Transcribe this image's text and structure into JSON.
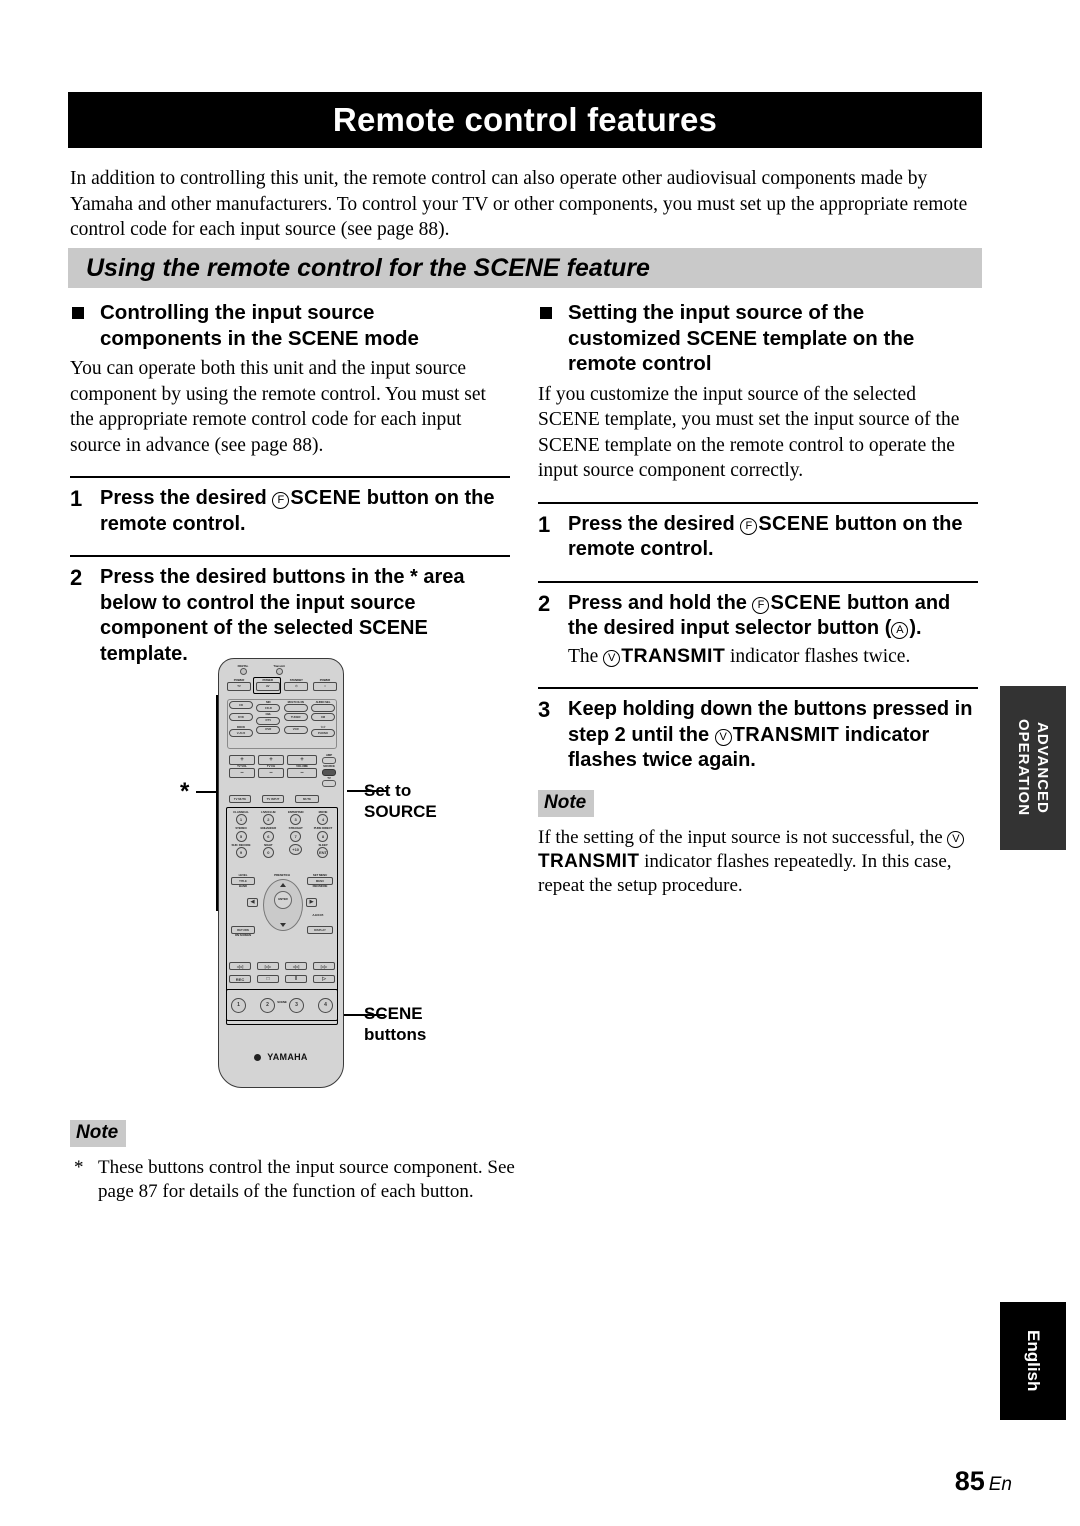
{
  "header": {
    "title": "Remote control features"
  },
  "intro": "In addition to controlling this unit, the remote control can also operate other audiovisual components made by Yamaha and other manufacturers. To control your TV or other components, you must set up the appropriate remote control code for each input source (see page 88).",
  "section": {
    "title": "Using the remote control for the SCENE feature"
  },
  "left_column": {
    "heading": "Controlling the input source components in the SCENE mode",
    "heading_line1": "Controlling the input source",
    "heading_line2": "components in the SCENE mode",
    "body": "You can operate both this unit and the input source component by using the remote control. You must set the appropriate remote control code for each input source in advance (see page 88).",
    "steps": [
      {
        "number": "1",
        "text_before": "Press the desired ",
        "circled": "F",
        "bold_token": "SCENE",
        "text_after": " button on the remote control."
      },
      {
        "number": "2",
        "text_before": "Press the desired buttons in the * area below to control the input source component of the selected SCENE template.",
        "circled": "",
        "bold_token": "",
        "text_after": ""
      }
    ],
    "note": {
      "badge": "Note",
      "star": "*",
      "text": "These buttons control the input source component. See page 87 for details of the function of each button."
    }
  },
  "right_column": {
    "heading_line1": "Setting the input source of the",
    "heading_line2": "customized SCENE template on the",
    "heading_line3": "remote control",
    "body": "If you customize the input source of the selected SCENE template, you must set the input source of the SCENE template on the remote control to operate the input source component correctly.",
    "steps": [
      {
        "number": "1",
        "text_before": "Press the desired ",
        "circled": "F",
        "bold_token": "SCENE",
        "text_after": " button on the remote control.",
        "sub": ""
      },
      {
        "number": "2",
        "text_before": "Press and hold the ",
        "circled": "F",
        "bold_token": "SCENE",
        "text_after": " button and the desired input selector button (",
        "circled2": "A",
        "text_end": ").",
        "sub_before": "The ",
        "sub_circled": "V",
        "sub_bold": "TRANSMIT",
        "sub_after": " indicator flashes twice."
      },
      {
        "number": "3",
        "text_before": "Keep holding down the buttons pressed in step 2 until the ",
        "circled": "V",
        "bold_token": "TRANSMIT",
        "text_after": " indicator flashes twice again.",
        "sub": ""
      }
    ],
    "note": {
      "badge": "Note",
      "text_before": "If the setting of the input source is not successful, the ",
      "circled": "V",
      "bold_token": "TRANSMIT",
      "text_after": " indicator flashes repeatedly. In this case, repeat the setup procedure."
    }
  },
  "remote_diagram": {
    "brand": "YAMAHA",
    "callouts": {
      "star": "*",
      "set_to_source_line1": "Set to",
      "set_to_source_line2": "SOURCE",
      "scene_line1": "SCENE",
      "scene_line2": "buttons"
    },
    "indicators": [
      {
        "label": "DIGITAL"
      },
      {
        "label": "Transmit"
      }
    ],
    "power_row": [
      {
        "top": "POWER",
        "label": "TV"
      },
      {
        "top": "POWER",
        "label": "AV"
      },
      {
        "top": "STANDBY",
        "label": "⏻"
      },
      {
        "top": "POWER",
        "label": "I"
      }
    ],
    "input_selectors": [
      {
        "top": "",
        "label": "CD"
      },
      {
        "top": "MD",
        "label": "CD-R"
      },
      {
        "top": "MULTI CH IN",
        "label": ""
      },
      {
        "top": "AUDIO SEL",
        "label": ""
      },
      {
        "top": "",
        "label": "DVD"
      },
      {
        "top": "CBL",
        "label": "DTV"
      },
      {
        "top": "",
        "label": "TUNER"
      },
      {
        "top": "",
        "label": "XM"
      },
      {
        "top": "DOCK",
        "label": "V-AUX"
      },
      {
        "top": "",
        "label": "DVR"
      },
      {
        "top": "",
        "label": "VCR"
      },
      {
        "top": "☆☆",
        "label": "PHONO"
      }
    ],
    "volume_controls": [
      {
        "plus": "+",
        "label": "TV VOL",
        "minus": "–"
      },
      {
        "plus": "+",
        "label": "TV CH",
        "minus": "–"
      },
      {
        "plus": "+",
        "label": "VOLUME",
        "minus": "–"
      }
    ],
    "mute_row": [
      {
        "label": "TV MUTE"
      },
      {
        "label": "TV INPUT"
      },
      {
        "label": "MUTE"
      }
    ],
    "mode_switch": [
      {
        "label": "AMP"
      },
      {
        "label": "SOURCE"
      },
      {
        "label": "TV"
      }
    ],
    "numeric_pad": [
      {
        "top": "CLASSICAL",
        "label": "1"
      },
      {
        "top": "LIVE/CLUB",
        "label": "2"
      },
      {
        "top": "ENTERTAIN",
        "label": "3"
      },
      {
        "top": "MOVIE",
        "label": "4"
      },
      {
        "top": "STEREO",
        "label": "5"
      },
      {
        "top": "ENHANCER",
        "label": "6"
      },
      {
        "top": "STRAIGHT",
        "label": "7"
      },
      {
        "top": "PURE DIRECT",
        "label": "8"
      },
      {
        "top": "SUR. DECODE",
        "label": "9"
      },
      {
        "top": "NIGHT",
        "label": "0"
      },
      {
        "top": "",
        "label": "+10"
      },
      {
        "top": "SLEEP",
        "label": "ENT"
      }
    ],
    "nav_section": {
      "title_top": "LEVEL",
      "title_btn": "TITLE",
      "band": "BAND",
      "preset_ch": "PRESET/CH",
      "set_menu": "SET MENU",
      "menu_btn": "MENU",
      "rec_mode": "REC/MODE",
      "enter": "ENTER",
      "a_b_c_d_e": "A-E/CAT.",
      "return_btn": "RETURN",
      "display_btn": "DISPLAY",
      "on_screen": "ON SCREEN"
    },
    "transport_row": [
      {
        "label": "◁◁"
      },
      {
        "label": "▷▷"
      },
      {
        "label": "◁◁"
      },
      {
        "label": "▷▷"
      }
    ],
    "transport_row2": [
      {
        "label": "REC"
      },
      {
        "label": "□"
      },
      {
        "label": "‖"
      },
      {
        "label": "▷"
      }
    ],
    "scene_group": {
      "label": "SCENE",
      "buttons": [
        "1",
        "2",
        "3",
        "4"
      ]
    }
  },
  "side_tabs": {
    "advanced": "ADVANCED OPERATION",
    "language": "English"
  },
  "footer": {
    "page": "85",
    "lang": "En"
  }
}
